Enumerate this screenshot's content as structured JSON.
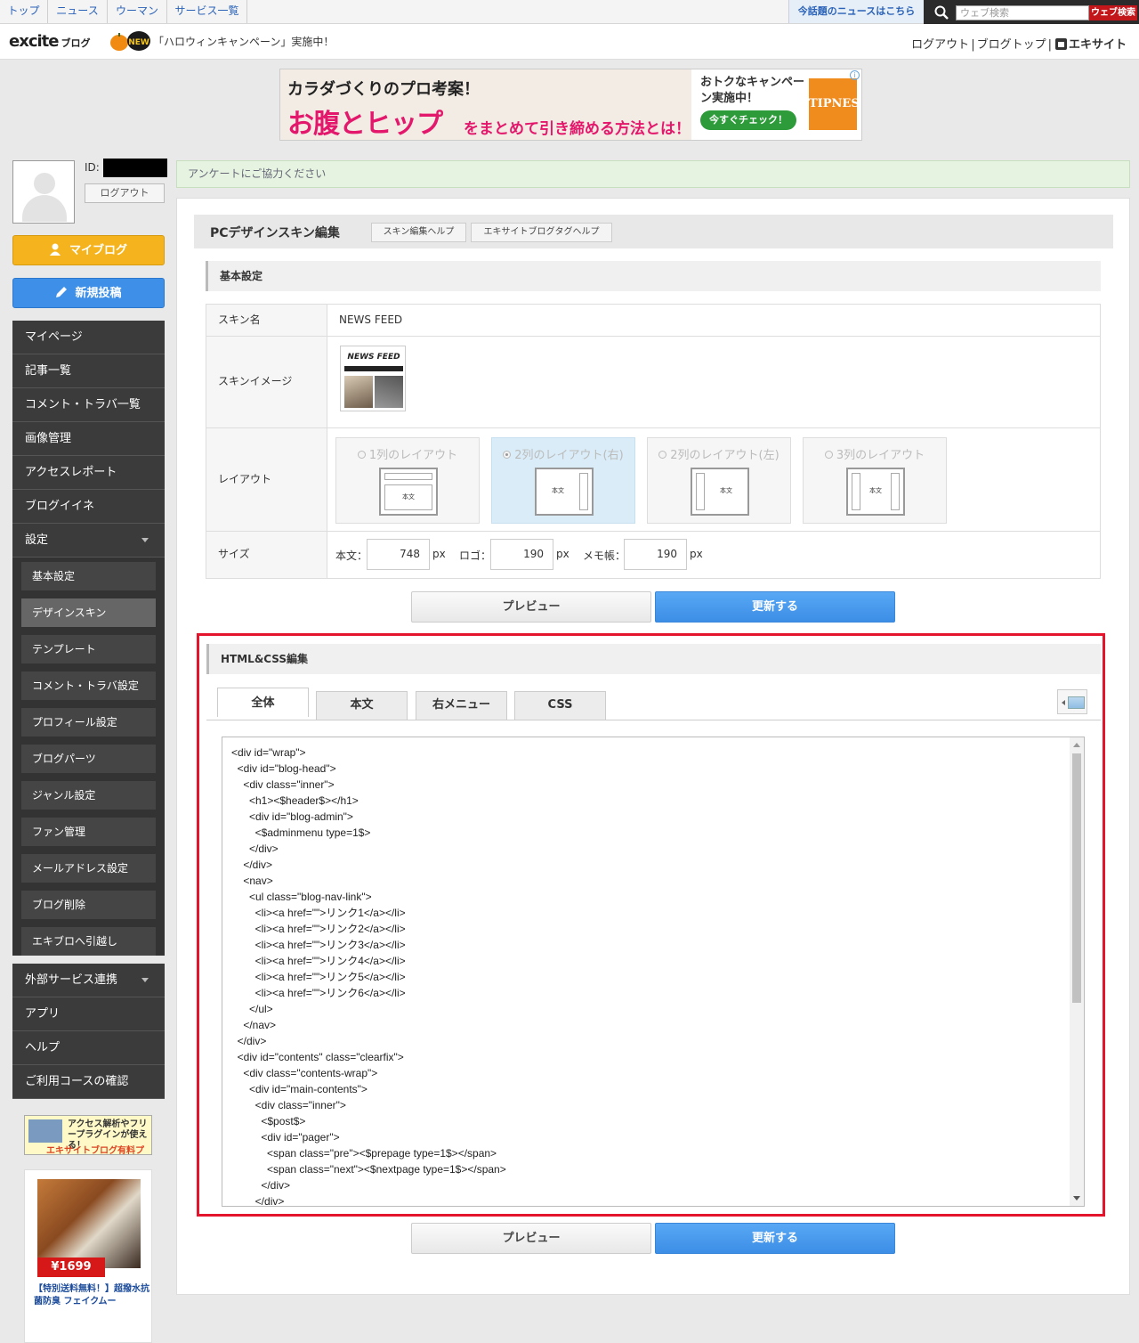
{
  "topnav": {
    "links": [
      "トップ",
      "ニュース",
      "ウーマン",
      "サービス一覧"
    ],
    "news_link": "今話題のニュースはこちら",
    "search_placeholder": "ウェブ検索",
    "search_button": "ウェブ検索"
  },
  "header": {
    "logo": "excite",
    "logo_sub": "ブログ",
    "badge": "NEW",
    "campaign": "「ハロウィンキャンペーン」実施中！",
    "links": [
      "ログアウト",
      "ブログトップ",
      "エキサイト"
    ],
    "separator": "|"
  },
  "ad": {
    "line1": "カラダづくりのプロ考案！",
    "line2": "お腹とヒップ",
    "line3": "をまとめて引き締める方法とは！",
    "right_text": "おトクなキャンペーン実施中！",
    "cta": "今すぐチェック！",
    "brand": "TIPNESS"
  },
  "user": {
    "id_label": "ID:",
    "logout": "ログアウト"
  },
  "buttons": {
    "myblog": "マイブログ",
    "newpost": "新規投稿"
  },
  "menu": {
    "items": [
      "マイページ",
      "記事一覧",
      "コメント・トラバ一覧",
      "画像管理",
      "アクセスレポート",
      "ブログイイネ",
      "設定"
    ],
    "sub": [
      "基本設定",
      "デザインスキン",
      "テンプレート",
      "コメント・トラバ設定",
      "プロフィール設定",
      "ブログパーツ",
      "ジャンル設定",
      "ファン管理",
      "メールアドレス設定",
      "ブログ削除",
      "エキブロへ引越し"
    ],
    "items2": [
      "外部サービス連携",
      "アプリ",
      "ヘルプ",
      "ご利用コースの確認"
    ]
  },
  "promo": {
    "text": "アクセス解析やフリープラグインが使える！",
    "sub": "エキサイトブログ有料プラン"
  },
  "shoe_ad": {
    "price": "¥1699",
    "caption": "【特別送料無料！】超撥水抗菌防臭 フェイクムー"
  },
  "survey": "アンケートにご協力ください",
  "panel": {
    "title": "PCデザインスキン編集",
    "help1": "スキン編集ヘルプ",
    "help2": "エキサイトブログタグヘルプ"
  },
  "basic": {
    "heading": "基本設定",
    "skin_name_label": "スキン名",
    "skin_name": "NEWS FEED",
    "skin_image_label": "スキンイメージ",
    "thumb_title": "NEWS FEED",
    "layout_label": "レイアウト",
    "layouts": [
      "1列のレイアウト",
      "2列のレイアウト(右)",
      "2列のレイアウト(左)",
      "3列のレイアウト"
    ],
    "layout_body": "本文",
    "size_label": "サイズ",
    "body_label": "本文：",
    "logo_label": "ロゴ：",
    "memo_label": "メモ帳：",
    "body_px": "748",
    "logo_px": "190",
    "memo_px": "190",
    "unit": "px"
  },
  "actions": {
    "preview": "プレビュー",
    "update": "更新する"
  },
  "html_css": {
    "heading": "HTML&CSS編集",
    "tabs": [
      "全体",
      "本文",
      "右メニュー",
      "CSS"
    ],
    "code": "<div id=\"wrap\">\n  <div id=\"blog-head\">\n    <div class=\"inner\">\n      <h1><$header$></h1>\n      <div id=\"blog-admin\">\n        <$adminmenu type=1$>\n      </div>\n    </div>\n    <nav>\n      <ul class=\"blog-nav-link\">\n        <li><a href=\"\">リンク1</a></li>\n        <li><a href=\"\">リンク2</a></li>\n        <li><a href=\"\">リンク3</a></li>\n        <li><a href=\"\">リンク4</a></li>\n        <li><a href=\"\">リンク5</a></li>\n        <li><a href=\"\">リンク6</a></li>\n      </ul>\n    </nav>\n  </div>\n  <div id=\"contents\" class=\"clearfix\">\n    <div class=\"contents-wrap\">\n      <div id=\"main-contents\">\n        <div class=\"inner\">\n          <$post$>\n          <div id=\"pager\">\n            <span class=\"pre\"><$prepage type=1$></span>\n            <span class=\"next\"><$nextpage type=1$></span>\n          </div>\n        </div>"
  },
  "colors": {
    "accent_blue": "#3c8ee6",
    "my_blog_orange": "#f5b41e",
    "highlight_red": "#e3142b",
    "menu_dark": "#3b3b3b"
  }
}
